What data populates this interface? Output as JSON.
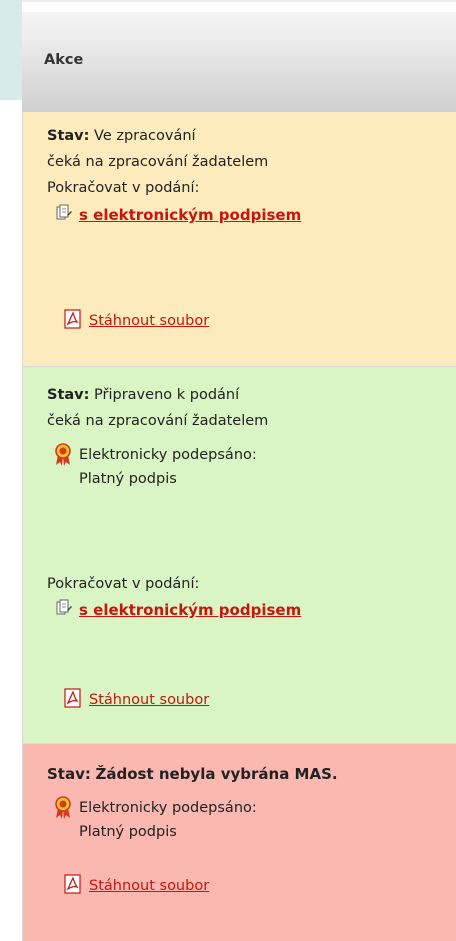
{
  "header": {
    "column_title": "Akce"
  },
  "rows": [
    {
      "status_label": "Stav:",
      "status_value": "Ve zpracování",
      "note": "čeká na zpracování žadatelem",
      "continue_label": "Pokračovat v podání:",
      "sign_link": "s elektronickým podpisem",
      "download_link": "Stáhnout soubor",
      "background": "#fdebbe"
    },
    {
      "status_label": "Stav:",
      "status_value": "Připraveno k podání",
      "note": "čeká na zpracování žadatelem",
      "signed_label": "Elektronicky podepsáno:",
      "signed_value": "Platný podpis",
      "continue_label": "Pokračovat v podání:",
      "sign_link": "s elektronickým podpisem",
      "download_link": "Stáhnout soubor",
      "background": "#d9f5c4"
    },
    {
      "status_label": "Stav:",
      "status_value": "Žádost nebyla vybrána MAS.",
      "signed_label": "Elektronicky podepsáno:",
      "signed_value": "Platný podpis",
      "download_link": "Stáhnout soubor",
      "background": "#fbb8b1"
    }
  ],
  "colors": {
    "link": "#c8160e",
    "header_gradient_end": "#cfcfcf"
  },
  "icons": {
    "sign": "document-signature-icon",
    "pdf": "pdf-icon",
    "badge": "award-ribbon-icon"
  }
}
